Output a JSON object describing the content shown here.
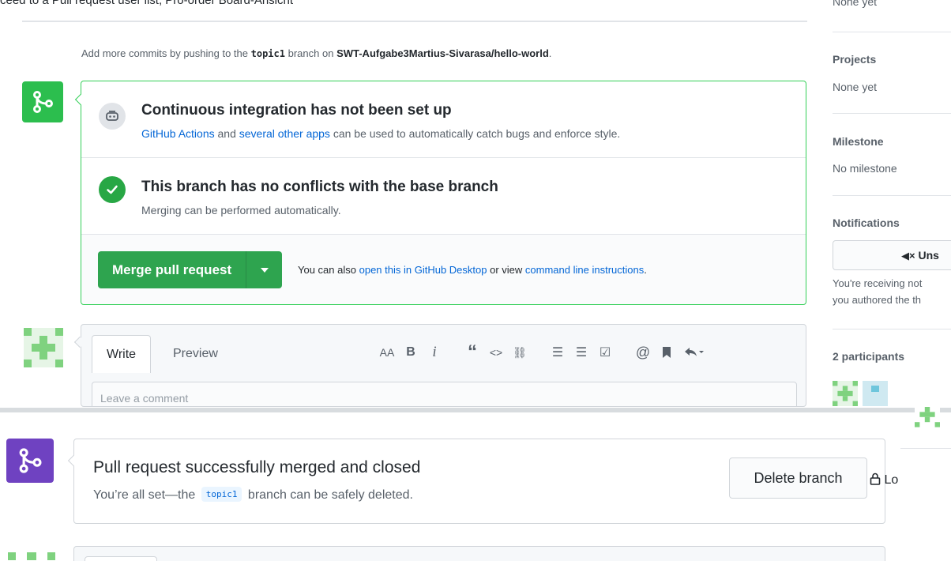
{
  "top_cut": {
    "text": "ceed to a Pull request user list, Pro-order Board-Ansicht",
    "extra": "None yet"
  },
  "push_note": {
    "prefix": "Add more commits by pushing to the",
    "branch": "topic1",
    "middle": "branch on",
    "repo": "SWT-Aufgabe3Martius-Sivarasa/hello-world",
    "suffix": "."
  },
  "merge_box": {
    "ci": {
      "title": "Continuous integration has not been set up",
      "link1": "GitHub Actions",
      "mid": "and",
      "link2": "several other apps",
      "rest": "can be used to automatically catch bugs and enforce style."
    },
    "conflicts": {
      "title": "This branch has no conflicts with the base branch",
      "subtitle": "Merging can be performed automatically."
    },
    "merge_button": "Merge pull request",
    "hint": {
      "prefix": "You can also",
      "link1": "open this in GitHub Desktop",
      "mid": "or view",
      "link2": "command line instructions",
      "suffix": "."
    }
  },
  "comment": {
    "tabs": [
      "Write",
      "Preview"
    ],
    "placeholder": "Leave a comment",
    "toolbar": {
      "heading": "AA",
      "bold": "B",
      "italic": "i",
      "quote": "“",
      "code": "<>",
      "link": "⛓",
      "ul": "☰",
      "ol": "☰",
      "task": "☑",
      "mention": "@",
      "ref": "🔖",
      "reply": "↩"
    }
  },
  "merged": {
    "title": "Pull request successfully merged and closed",
    "sub_prefix": "You’re all set—the",
    "branch": "topic1",
    "sub_suffix": "branch can be safely deleted.",
    "delete_button": "Delete branch"
  },
  "sidebar": {
    "top_value": "None yet",
    "projects": {
      "label": "Projects",
      "value": "None yet"
    },
    "milestone": {
      "label": "Milestone",
      "value": "No milestone"
    },
    "notifications": {
      "label": "Notifications",
      "button": "Uns",
      "note_line1": "You're receiving not",
      "note_line2": "you authored the th"
    },
    "participants": {
      "label": "2 participants"
    },
    "lock": "Lo"
  },
  "colors": {
    "green": "#2ea44f",
    "purple": "#6f42c1",
    "link": "#0366d6"
  }
}
